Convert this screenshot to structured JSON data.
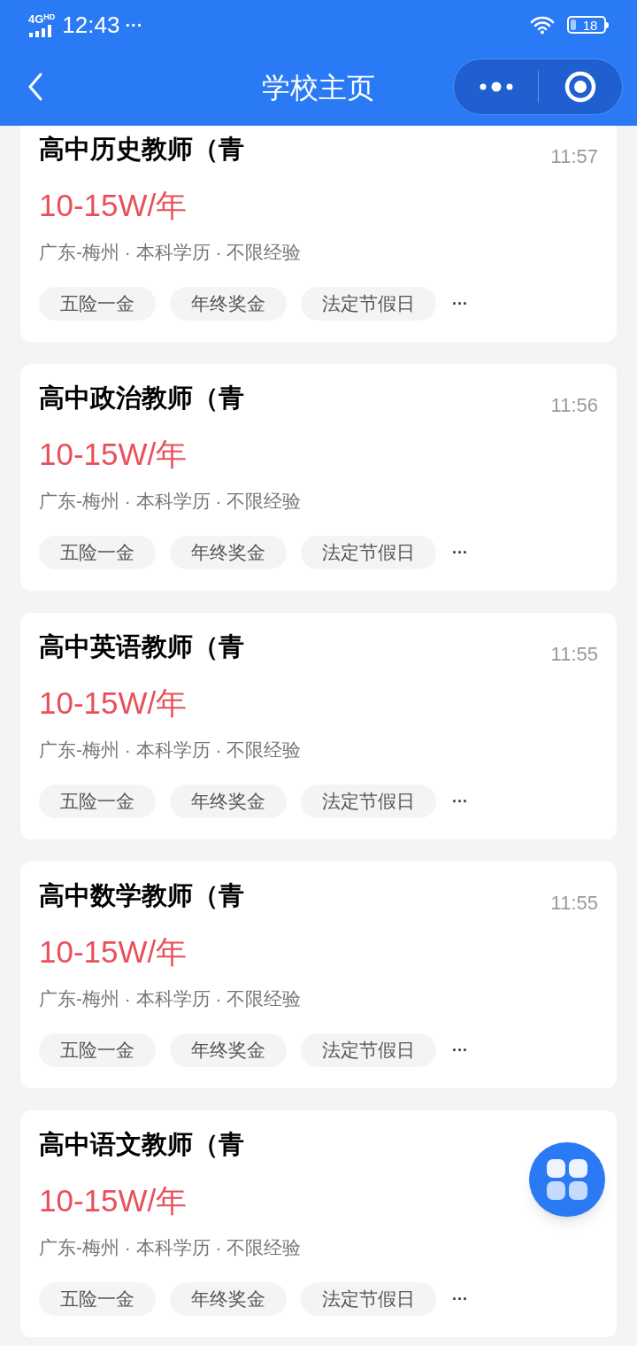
{
  "status_bar": {
    "network": "4G",
    "network_badge": "HD",
    "time": "12:43",
    "more": "···",
    "battery": "18"
  },
  "header": {
    "title": "学校主页"
  },
  "jobs": [
    {
      "title": "高中历史教师（青",
      "time": "11:57",
      "salary": "10-15W/年",
      "meta": "广东-梅州 · 本科学历 · 不限经验",
      "tags": [
        "五险一金",
        "年终奖金",
        "法定节假日"
      ],
      "more": "···"
    },
    {
      "title": "高中政治教师（青",
      "time": "11:56",
      "salary": "10-15W/年",
      "meta": "广东-梅州 · 本科学历 · 不限经验",
      "tags": [
        "五险一金",
        "年终奖金",
        "法定节假日"
      ],
      "more": "···"
    },
    {
      "title": "高中英语教师（青",
      "time": "11:55",
      "salary": "10-15W/年",
      "meta": "广东-梅州 · 本科学历 · 不限经验",
      "tags": [
        "五险一金",
        "年终奖金",
        "法定节假日"
      ],
      "more": "···"
    },
    {
      "title": "高中数学教师（青",
      "time": "11:55",
      "salary": "10-15W/年",
      "meta": "广东-梅州 · 本科学历 · 不限经验",
      "tags": [
        "五险一金",
        "年终奖金",
        "法定节假日"
      ],
      "more": "···"
    },
    {
      "title": "高中语文教师（青",
      "salary": "10-15W/年",
      "meta": "广东-梅州 · 本科学历 · 不限经验",
      "tags": [
        "五险一金",
        "年终奖金",
        "法定节假日"
      ],
      "more": "···"
    }
  ]
}
